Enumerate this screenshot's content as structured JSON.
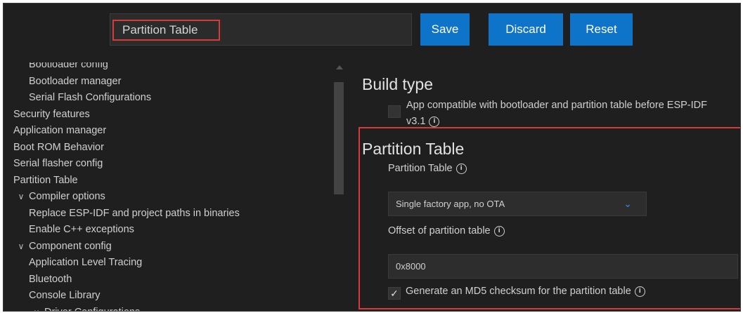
{
  "toolbar": {
    "search_value": "Partition Table",
    "save_label": "Save",
    "discard_label": "Discard",
    "reset_label": "Reset"
  },
  "sidebar": {
    "items": [
      {
        "label": "Bootloader config",
        "level": 1,
        "chevron": false
      },
      {
        "label": "Bootloader manager",
        "level": 1,
        "chevron": false
      },
      {
        "label": "Serial Flash Configurations",
        "level": 1,
        "chevron": false
      },
      {
        "label": "Security features",
        "level": 0,
        "chevron": false
      },
      {
        "label": "Application manager",
        "level": 0,
        "chevron": false
      },
      {
        "label": "Boot ROM Behavior",
        "level": 0,
        "chevron": false
      },
      {
        "label": "Serial flasher config",
        "level": 0,
        "chevron": false
      },
      {
        "label": "Partition Table",
        "level": 0,
        "chevron": false
      },
      {
        "label": "Compiler options",
        "level": 0,
        "chevron": true
      },
      {
        "label": "Replace ESP-IDF and project paths in binaries",
        "level": 1,
        "chevron": false
      },
      {
        "label": "Enable C++ exceptions",
        "level": 1,
        "chevron": false
      },
      {
        "label": "Component config",
        "level": 0,
        "chevron": true
      },
      {
        "label": "Application Level Tracing",
        "level": 1,
        "chevron": false
      },
      {
        "label": "Bluetooth",
        "level": 1,
        "chevron": false
      },
      {
        "label": "Console Library",
        "level": 1,
        "chevron": false
      },
      {
        "label": "Driver Configurations",
        "level": 1,
        "chevron": true
      }
    ]
  },
  "main": {
    "build_type_heading": "Build type",
    "build_option_label": "App compatible with bootloader and partition table before ESP-IDF v3.1",
    "partition_heading": "Partition Table",
    "partition_table_label": "Partition Table",
    "partition_table_value": "Single factory app, no OTA",
    "offset_label": "Offset of partition table",
    "offset_value": "0x8000",
    "md5_label": "Generate an MD5 checksum for the partition table",
    "md5_checked": true
  },
  "colors": {
    "button_blue": "#0e74c9",
    "highlight_red": "#d63a3a",
    "background": "#1f1f1f"
  }
}
